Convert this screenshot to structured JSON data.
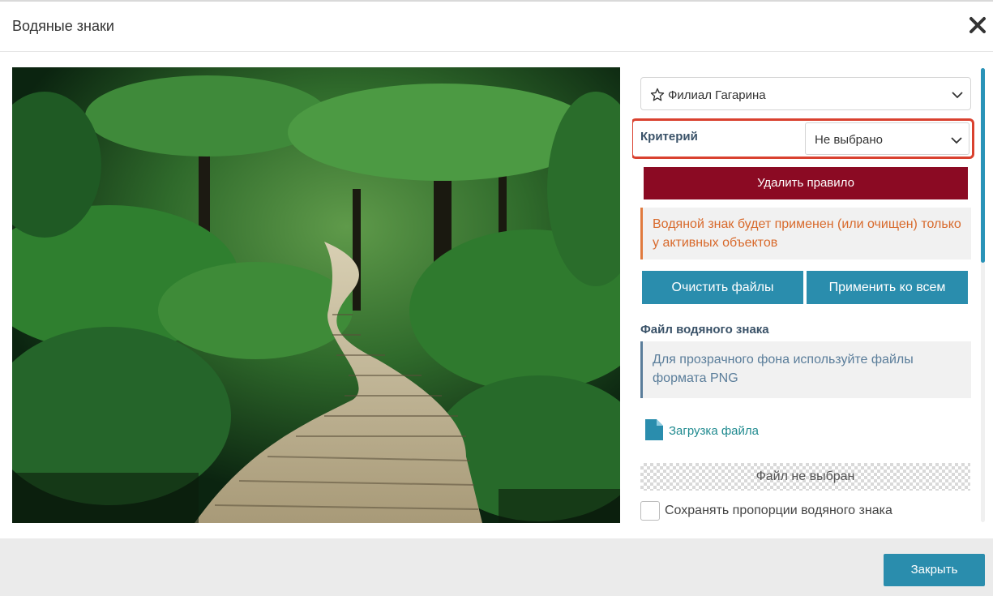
{
  "dialog": {
    "title": "Водяные знаки",
    "close_icon": "close-icon"
  },
  "preview": {
    "image_description_icon": "forest-path-photo"
  },
  "panel": {
    "branch_select": {
      "value": "Филиал Гагарина",
      "icon": "star-icon"
    },
    "criteria": {
      "label": "Критерий",
      "value": "Не выбрано",
      "highlight_color": "#d9412f"
    },
    "delete_rule_button": "Удалить правило",
    "warning_text": "Водяной знак будет применен (или очищен) только у активных объектов",
    "clear_files_button": "Очистить файлы",
    "apply_all_button": "Применить ко всем",
    "watermark_file_heading": "Файл водяного знака",
    "info_text": "Для прозрачного фона используйте файлы формата PNG",
    "upload_link": "Загрузка файла",
    "no_file_text": "Файл не выбран",
    "keep_proportions_label": "Сохранять пропорции водяного знака",
    "keep_proportions_checked": false
  },
  "footer": {
    "close_button": "Закрыть"
  },
  "colors": {
    "accent": "#2a8dad",
    "danger": "#8b0a23",
    "warning": "#d8692b",
    "info": "#5a7d9a"
  }
}
